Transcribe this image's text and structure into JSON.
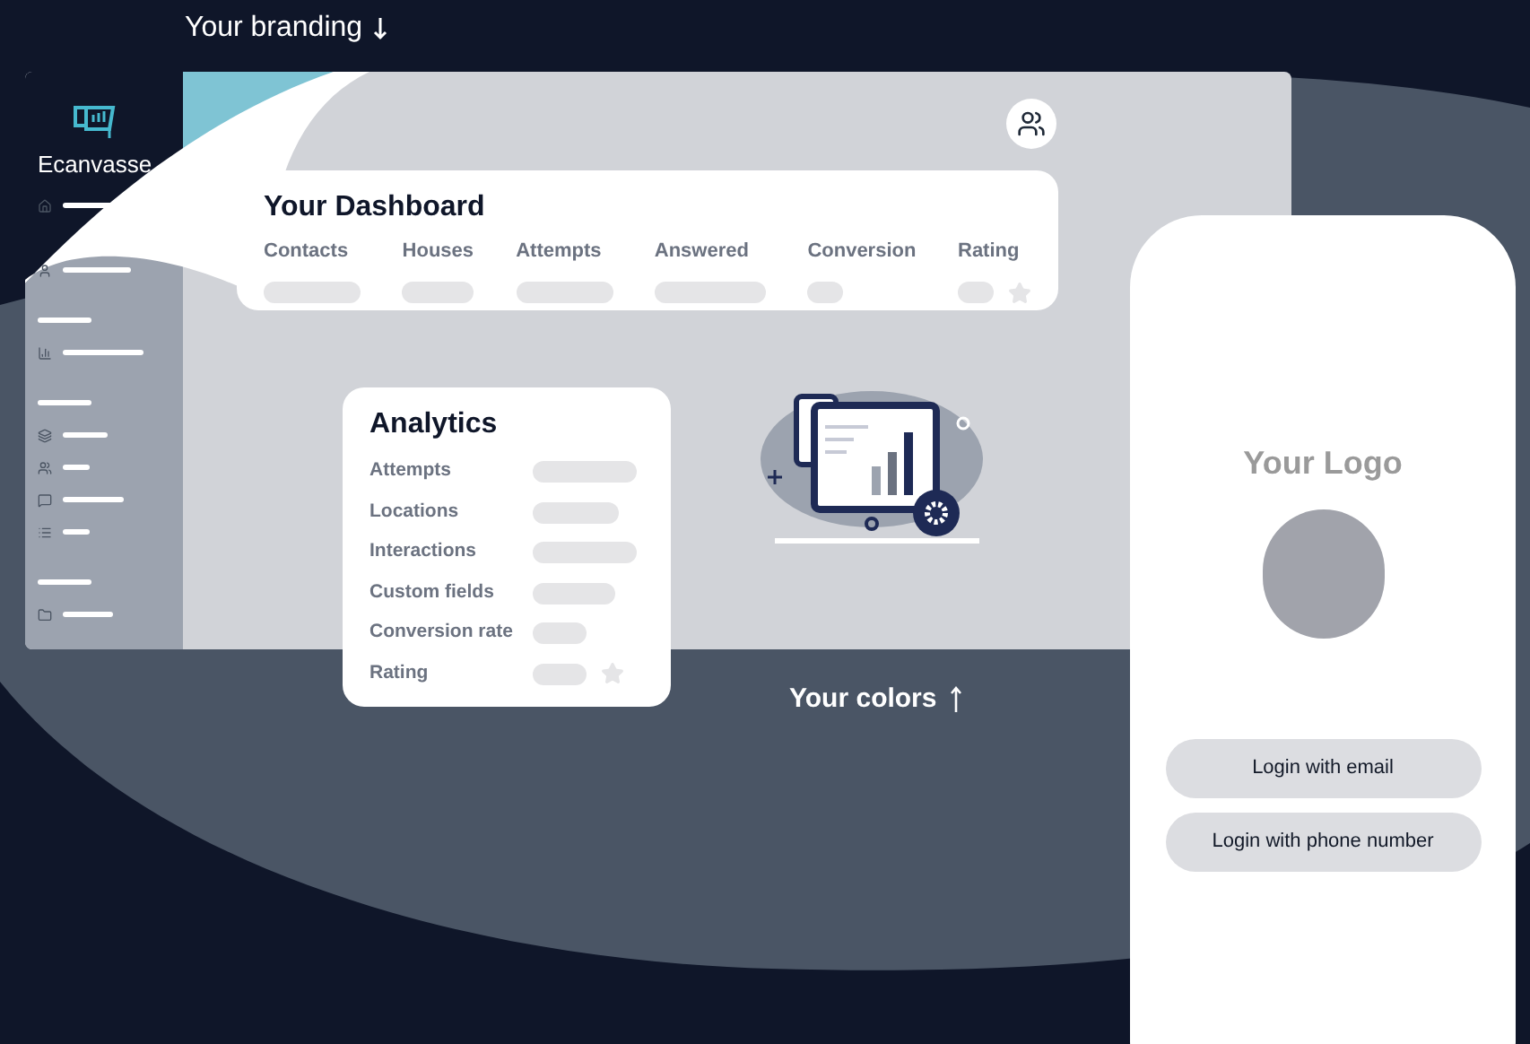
{
  "captions": {
    "branding": "Your branding",
    "colors": "Your colors"
  },
  "sidebar": {
    "brand": "Ecanvasse"
  },
  "dashboard": {
    "title": "Your Dashboard",
    "stats": [
      {
        "label": "Contacts",
        "kind": "bar"
      },
      {
        "label": "Houses",
        "kind": "bar"
      },
      {
        "label": "Attempts",
        "kind": "bar"
      },
      {
        "label": "Answered",
        "kind": "bar"
      },
      {
        "label": "Conversion",
        "kind": "bar"
      },
      {
        "label": "Rating",
        "kind": "rating"
      }
    ]
  },
  "analytics": {
    "title": "Analytics",
    "rows": [
      {
        "label": "Attempts",
        "kind": "bar"
      },
      {
        "label": "Locations",
        "kind": "bar"
      },
      {
        "label": "Interactions",
        "kind": "bar"
      },
      {
        "label": "Custom fields",
        "kind": "bar"
      },
      {
        "label": "Conversion rate",
        "kind": "bar"
      },
      {
        "label": "Rating",
        "kind": "rating"
      }
    ]
  },
  "login": {
    "logo_text": "Your Logo",
    "buttons": [
      "Login with email",
      "Login with phone number"
    ]
  }
}
